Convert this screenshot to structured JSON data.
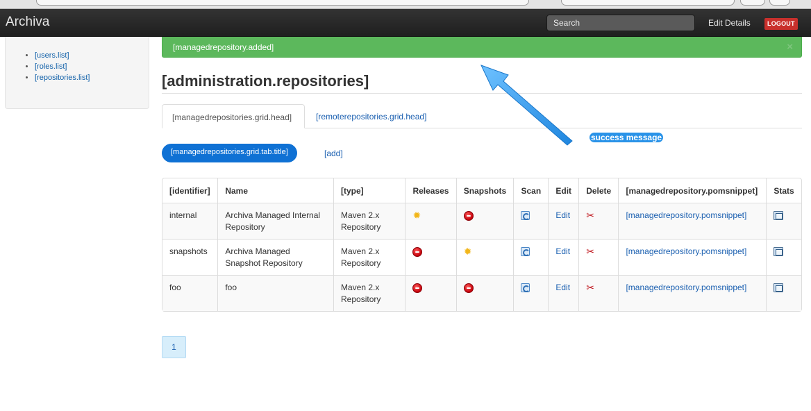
{
  "app": {
    "brand": "Archiva"
  },
  "navbar": {
    "search_placeholder": "Search",
    "edit_details": "Edit Details",
    "logout": "LOGOUT"
  },
  "sidebar": {
    "items": [
      {
        "label": "[users.list]"
      },
      {
        "label": "[roles.list]"
      },
      {
        "label": "[repositories.list]"
      }
    ]
  },
  "alert": {
    "message": "[managedrepository.added]",
    "close": "×"
  },
  "page": {
    "title": "[administration.repositories]"
  },
  "tabs": [
    {
      "label": "[managedrepositories.grid.head]",
      "active": true
    },
    {
      "label": "[remoterepositories.grid.head]",
      "active": false
    }
  ],
  "pills": {
    "active": "[managedrepositories.grid.tab.title]",
    "add": "[add]"
  },
  "table": {
    "columns": [
      "[identifier]",
      "Name",
      "[type]",
      "Releases",
      "Snapshots",
      "Scan",
      "Edit",
      "Delete",
      "[managedrepository.pomsnippet]",
      "Stats"
    ],
    "rows": [
      {
        "identifier": "internal",
        "name": "Archiva Managed Internal Repository",
        "type": "Maven 2.x Repository",
        "releases": "sun-icon",
        "snapshots": "stop-icon",
        "edit": "Edit",
        "pom": "[managedrepository.pomsnippet]"
      },
      {
        "identifier": "snapshots",
        "name": "Archiva Managed Snapshot Repository",
        "type": "Maven 2.x Repository",
        "releases": "stop-icon",
        "snapshots": "sun-icon",
        "edit": "Edit",
        "pom": "[managedrepository.pomsnippet]"
      },
      {
        "identifier": "foo",
        "name": "foo",
        "type": "Maven 2.x Repository",
        "releases": "stop-icon",
        "snapshots": "stop-icon",
        "edit": "Edit",
        "pom": "[managedrepository.pomsnippet]"
      }
    ]
  },
  "annotation": {
    "label": "success message"
  },
  "pagination": {
    "current": "1"
  },
  "colors": {
    "alert_green": "#5cb85c",
    "primary_blue": "#0f71d4",
    "annotation_blue": "#2a93e8",
    "logout_red": "#c9302c"
  }
}
